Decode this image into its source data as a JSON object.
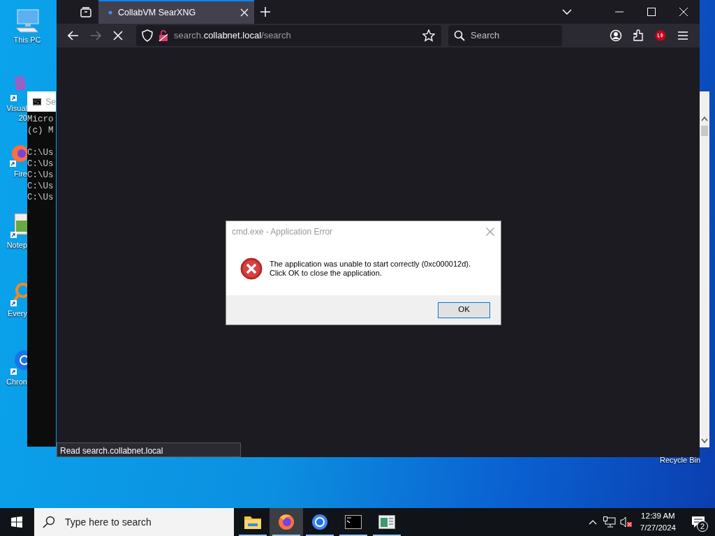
{
  "desktop_icons": [
    {
      "kind": "computer",
      "label_lines": [
        "This PC"
      ]
    },
    {
      "kind": "studio",
      "label_lines": [
        "Visual",
        "20"
      ]
    },
    {
      "kind": "firefox",
      "label_lines": [
        "Fire"
      ]
    },
    {
      "kind": "notepad",
      "label_lines": [
        "Notep"
      ]
    },
    {
      "kind": "everything",
      "label_lines": [
        "Every"
      ]
    },
    {
      "kind": "chrome",
      "label_lines": [
        "Chron"
      ]
    }
  ],
  "recycle_bin": {
    "label": "Recycle Bin"
  },
  "console_window": {
    "title": "Se",
    "header_lines": [
      "Micro",
      "(c) M"
    ],
    "prompt_lines": [
      "C:\\Us",
      "C:\\Us",
      "C:\\Us",
      "C:\\Us",
      "C:\\Us"
    ]
  },
  "browser": {
    "tabs": [
      {
        "title": "CollabVM SearXNG",
        "selected": true
      }
    ],
    "loading": true,
    "forward_disabled": true,
    "url_parts": [
      "search.",
      "collabnet.local",
      "/search"
    ],
    "search": {
      "placeholder": "Search"
    },
    "status_text": "Read search.collabnet.local"
  },
  "dialog": {
    "title": "cmd.exe - Application Error",
    "active": false,
    "message_lines": [
      "The application was unable to start correctly (0xc000012d).",
      "Click OK to close the application."
    ],
    "button": "OK"
  },
  "taskbar": {
    "search_placeholder": "Type here to search",
    "apps": [
      {
        "kind": "explorer",
        "active": false
      },
      {
        "kind": "firefox",
        "active": true
      },
      {
        "kind": "chrome",
        "active": false
      },
      {
        "kind": "console",
        "active": false
      },
      {
        "kind": "app",
        "active": false
      }
    ],
    "volume_muted": true,
    "time": "12:39 AM",
    "date": "7/27/2024",
    "notification_count": "2"
  }
}
